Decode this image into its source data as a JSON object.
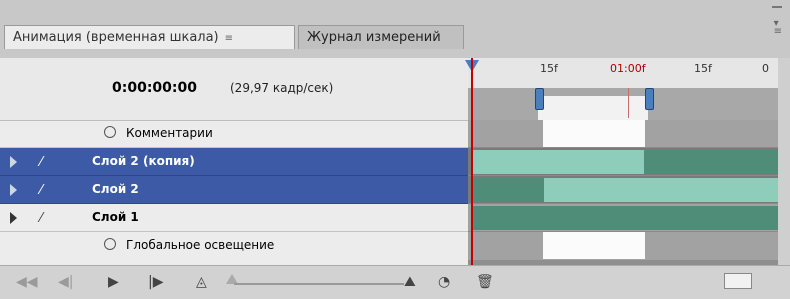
{
  "tabs": [
    {
      "label": "Анимация (временная шкала)",
      "active": true
    },
    {
      "label": "Журнал измерений",
      "active": false
    }
  ],
  "header": {
    "timecode": "0:00:00:00",
    "fps": "(29,97 кадр/сек)"
  },
  "ruler": {
    "ticks": [
      "15f",
      "01:00f",
      "15f",
      "0"
    ]
  },
  "rows": [
    {
      "label": "Комментарии",
      "type": "property",
      "selected": false
    },
    {
      "label": "Слой 2 (копия)",
      "type": "layer",
      "selected": true
    },
    {
      "label": "Слой 2",
      "type": "layer",
      "selected": true
    },
    {
      "label": "Слой 1",
      "type": "layer",
      "selected": false
    },
    {
      "label": "Глобальное освещение",
      "type": "property",
      "selected": false
    }
  ],
  "colors": {
    "selection": "#3c5aa6",
    "playhead": "#c40000",
    "layer_bar_dark": "#4f8d79",
    "layer_bar_light": "#8fcdbb",
    "handle": "#4a7fbf"
  },
  "icons": {
    "menu": "panel-menu-icon",
    "first_frame": "first-frame-icon",
    "prev_frame": "prev-frame-icon",
    "play": "play-icon",
    "next_frame": "next-frame-icon",
    "audio": "audio-icon",
    "zoom_small": "zoom-out-mountain-icon",
    "zoom_large": "zoom-in-mountain-icon",
    "tween": "tween-icon",
    "trash": "trash-icon"
  }
}
